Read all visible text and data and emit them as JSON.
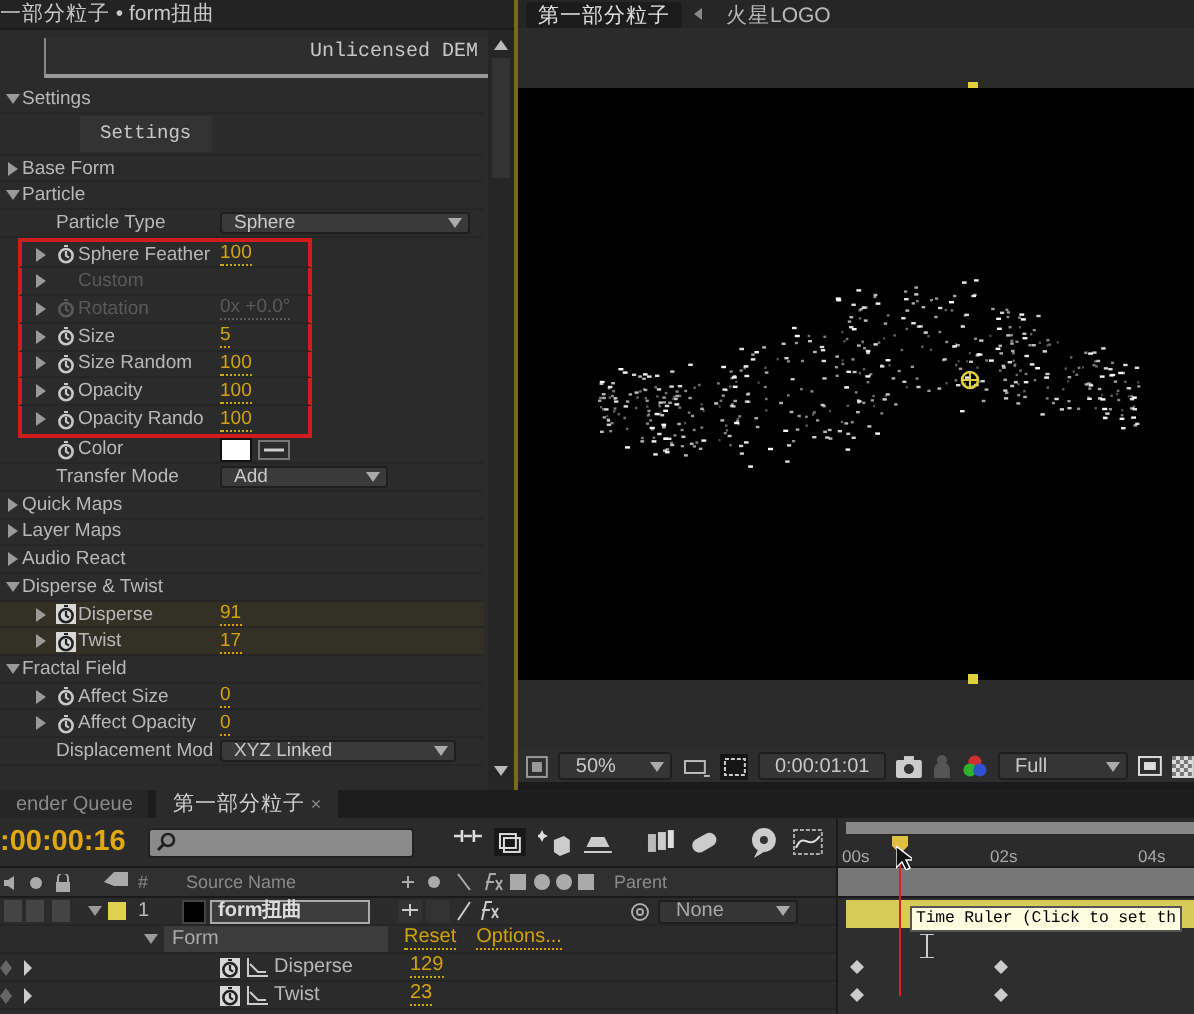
{
  "effect_panel": {
    "title": "一部分粒子 • form扭曲",
    "banner": "Unlicensed DEM",
    "rows": [
      {
        "kind": "section",
        "label": "Settings",
        "expanded": true,
        "children": [
          {
            "kind": "button",
            "label": "Settings"
          }
        ]
      },
      {
        "kind": "section",
        "label": "Base Form",
        "expanded": false
      },
      {
        "kind": "section",
        "label": "Particle",
        "expanded": true,
        "children": [
          {
            "kind": "dropdown",
            "label": "Particle Type",
            "value": "Sphere"
          },
          {
            "kind": "param",
            "label": "Sphere Feather",
            "value": "100",
            "expanded": false,
            "disabled": false,
            "keyframed": false,
            "highlighted": true
          },
          {
            "kind": "group",
            "label": "Custom",
            "expanded": false,
            "disabled": true,
            "highlighted": true
          },
          {
            "kind": "param",
            "label": "Rotation",
            "value": "0x +0.0°",
            "expanded": false,
            "disabled": true,
            "keyframed": false,
            "highlighted": true
          },
          {
            "kind": "param",
            "label": "Size",
            "value": "5",
            "expanded": false,
            "disabled": false,
            "keyframed": false,
            "highlighted": true
          },
          {
            "kind": "param",
            "label": "Size Random",
            "value": "100",
            "expanded": false,
            "disabled": false,
            "keyframed": false,
            "highlighted": true
          },
          {
            "kind": "param",
            "label": "Opacity",
            "value": "100",
            "expanded": false,
            "disabled": false,
            "keyframed": false,
            "highlighted": true
          },
          {
            "kind": "param",
            "label": "Opacity Rando",
            "value": "100",
            "expanded": false,
            "disabled": false,
            "keyframed": false,
            "highlighted": true
          },
          {
            "kind": "color",
            "label": "Color",
            "color": "#ffffff"
          },
          {
            "kind": "dropdown",
            "label": "Transfer Mode",
            "value": "Add"
          }
        ]
      },
      {
        "kind": "section",
        "label": "Quick Maps",
        "expanded": false
      },
      {
        "kind": "section",
        "label": "Layer Maps",
        "expanded": false
      },
      {
        "kind": "section",
        "label": "Audio React",
        "expanded": false
      },
      {
        "kind": "section",
        "label": "Disperse & Twist",
        "expanded": true,
        "children": [
          {
            "kind": "param",
            "label": "Disperse",
            "value": "91",
            "expanded": false,
            "disabled": false,
            "keyframed": true,
            "highlighted": false
          },
          {
            "kind": "param",
            "label": "Twist",
            "value": "17",
            "expanded": false,
            "disabled": false,
            "keyframed": true,
            "highlighted": false
          }
        ]
      },
      {
        "kind": "section",
        "label": "Fractal Field",
        "expanded": true,
        "children": [
          {
            "kind": "param",
            "label": "Affect Size",
            "value": "0",
            "expanded": false,
            "disabled": false,
            "keyframed": false,
            "highlighted": false
          },
          {
            "kind": "param",
            "label": "Affect Opacity",
            "value": "0",
            "expanded": false,
            "disabled": false,
            "keyframed": false,
            "highlighted": false
          },
          {
            "kind": "dropdown",
            "label": "Displacement Mod",
            "value": "XYZ Linked"
          }
        ]
      }
    ]
  },
  "viewer": {
    "tabs": [
      {
        "label": "第一部分粒子",
        "selected": true
      },
      {
        "label": "火星LOGO",
        "selected": false
      }
    ],
    "toolbar": {
      "zoom": "50%",
      "timecode": "0:00:01:01",
      "resolution": "Full"
    }
  },
  "timeline": {
    "tabs": [
      {
        "label": "ender Queue",
        "selected": false
      },
      {
        "label": "第一部分粒子",
        "selected": true,
        "close": "×"
      }
    ],
    "timecode": ":00:00:16",
    "columns": [
      "#",
      "Source Name",
      "Parent"
    ],
    "layers": [
      {
        "number": "1",
        "color": "#e0d050",
        "name": "form扭曲",
        "parent": "None",
        "expanded": true,
        "children": [
          {
            "name": "Form",
            "expanded": true,
            "links": [
              "Reset",
              "Options..."
            ],
            "children": [
              {
                "name": "Disperse",
                "value": "129"
              },
              {
                "name": "Twist",
                "value": "23"
              }
            ]
          }
        ]
      }
    ],
    "ruler": [
      "00s",
      "02s",
      "04s"
    ],
    "tooltip": "Time Ruler (Click to set th"
  }
}
